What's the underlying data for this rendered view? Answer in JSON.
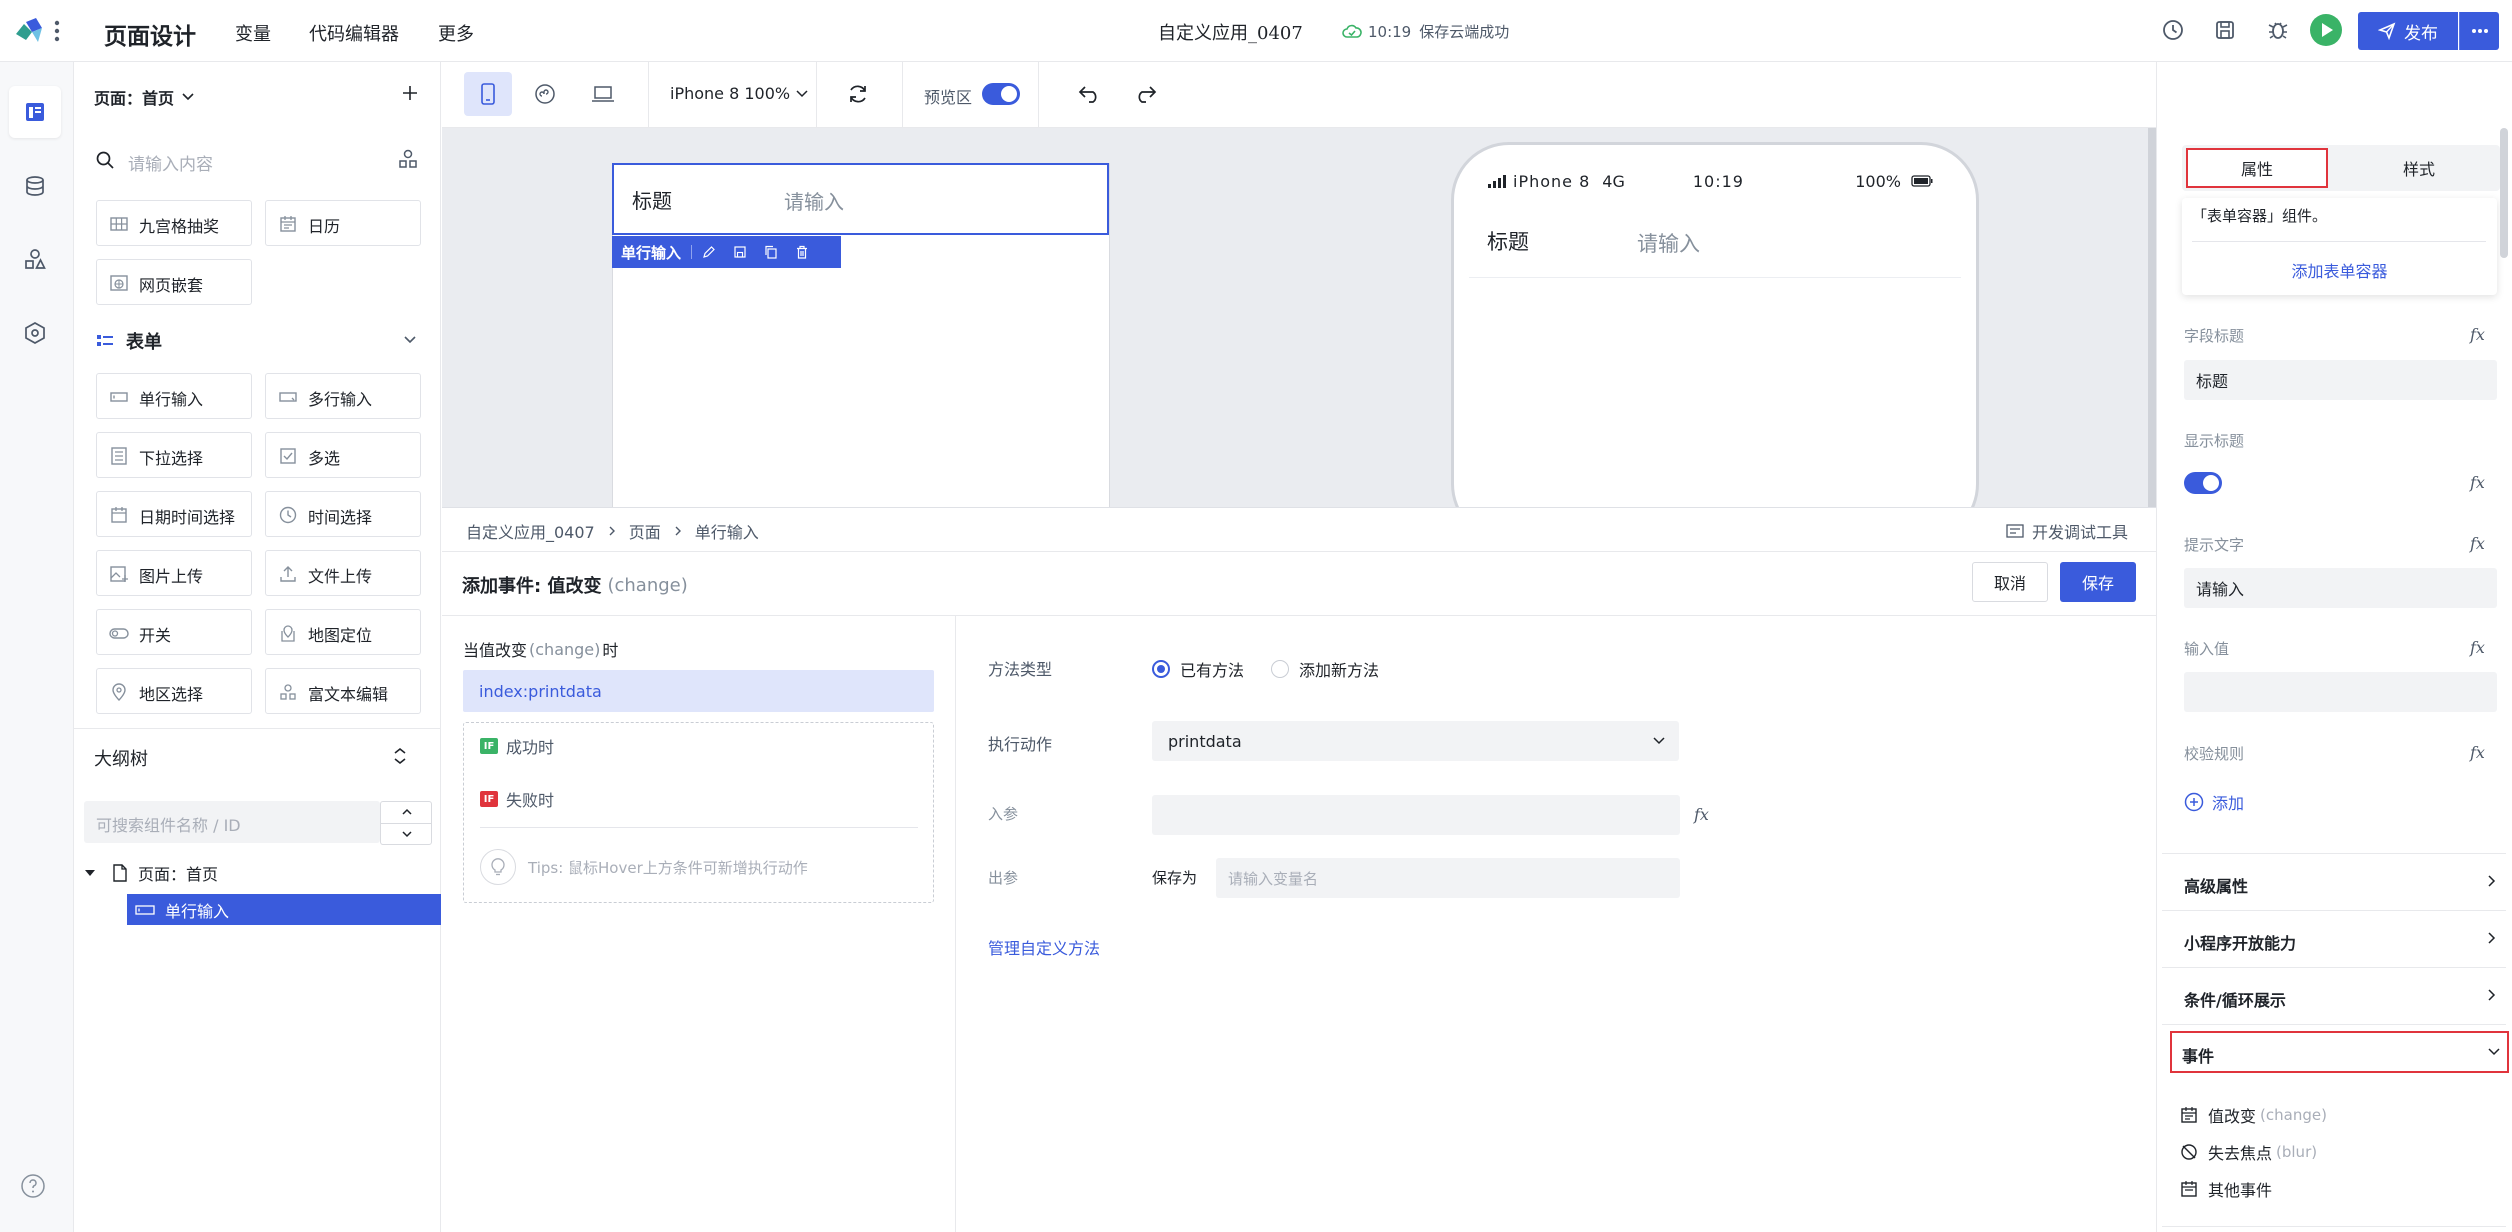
{
  "topbar": {
    "app_title": "页面设计",
    "nav": [
      "变量",
      "代码编辑器",
      "更多"
    ],
    "app_name": "自定义应用_0407",
    "save_time": "10:19",
    "save_status": "保存云端成功",
    "publish_label": "发布"
  },
  "components": {
    "page_selector": "页面：首页",
    "search_placeholder": "请输入内容",
    "top_items": [
      {
        "label": "九宫格抽奖",
        "icon": "grid-icon"
      },
      {
        "label": "日历",
        "icon": "calendar-icon"
      },
      {
        "label": "网页嵌套",
        "icon": "web-embed-icon"
      }
    ],
    "form_section_title": "表单",
    "form_items": [
      {
        "label": "单行输入",
        "icon": "single-input-icon"
      },
      {
        "label": "多行输入",
        "icon": "multi-input-icon"
      },
      {
        "label": "下拉选择",
        "icon": "dropdown-icon"
      },
      {
        "label": "多选",
        "icon": "checkbox-icon"
      },
      {
        "label": "日期时间选择",
        "icon": "datetime-icon"
      },
      {
        "label": "时间选择",
        "icon": "clock-icon"
      },
      {
        "label": "图片上传",
        "icon": "image-upload-icon"
      },
      {
        "label": "文件上传",
        "icon": "file-upload-icon"
      },
      {
        "label": "开关",
        "icon": "switch-icon"
      },
      {
        "label": "地图定位",
        "icon": "map-location-icon"
      },
      {
        "label": "地区选择",
        "icon": "region-icon"
      },
      {
        "label": "富文本编辑",
        "icon": "rich-text-icon"
      }
    ]
  },
  "outline": {
    "title": "大纲树",
    "search_placeholder": "可搜索组件名称 / ID",
    "root": "页面：首页",
    "selected": "单行输入"
  },
  "toolbar": {
    "device": "iPhone 8 100%",
    "preview_label": "预览区",
    "preview_enabled": true
  },
  "canvas": {
    "field_title": "标题",
    "field_placeholder": "请输入",
    "selection_label": "单行输入",
    "phone": {
      "carrier": "iPhone 8",
      "network": "4G",
      "time": "10:19",
      "battery": "100%"
    }
  },
  "breadcrumb": {
    "items": [
      "自定义应用_0407",
      "页面",
      "单行输入"
    ],
    "dev_tools": "开发调试工具"
  },
  "event_editor": {
    "title_prefix": "添加事件: 值改变",
    "title_event": "(change)",
    "cancel": "取消",
    "save": "保存",
    "trigger_prefix": "当值改变",
    "trigger_event": "(change)",
    "trigger_suffix": "时",
    "action_selected": "index:printdata",
    "success_label": "成功时",
    "fail_label": "失败时",
    "tips": "Tips: 鼠标Hover上方条件可新增执行动作",
    "method_type_label": "方法类型",
    "method_options": [
      "已有方法",
      "添加新方法"
    ],
    "method_selected": 0,
    "action_label": "执行动作",
    "action_value": "printdata",
    "param_in_label": "入参",
    "param_out_label": "出参",
    "save_as_label": "保存为",
    "save_as_placeholder": "请输入变量名",
    "manage_link": "管理自定义方法"
  },
  "properties": {
    "tabs": [
      "属性",
      "样式"
    ],
    "active_tab": 0,
    "hint_text": "「表单容器」组件。",
    "add_container": "添加表单容器",
    "field_title_label": "字段标题",
    "field_title_value": "标题",
    "show_title_label": "显示标题",
    "show_title_enabled": true,
    "placeholder_label": "提示文字",
    "placeholder_value": "请输入",
    "input_value_label": "输入值",
    "input_value": "",
    "validation_label": "校验规则",
    "add_label": "添加",
    "fx": "fx",
    "sections": [
      "高级属性",
      "小程序开放能力",
      "条件/循环展示",
      "事件"
    ],
    "events": [
      {
        "label": "值改变",
        "event": "(change)"
      },
      {
        "label": "失去焦点",
        "event": "(blur)"
      },
      {
        "label": "其他事件",
        "event": ""
      }
    ]
  },
  "colors": {
    "primary": "#3a5bdc",
    "success": "#3ab367",
    "highlight_border": "#e0343c"
  }
}
